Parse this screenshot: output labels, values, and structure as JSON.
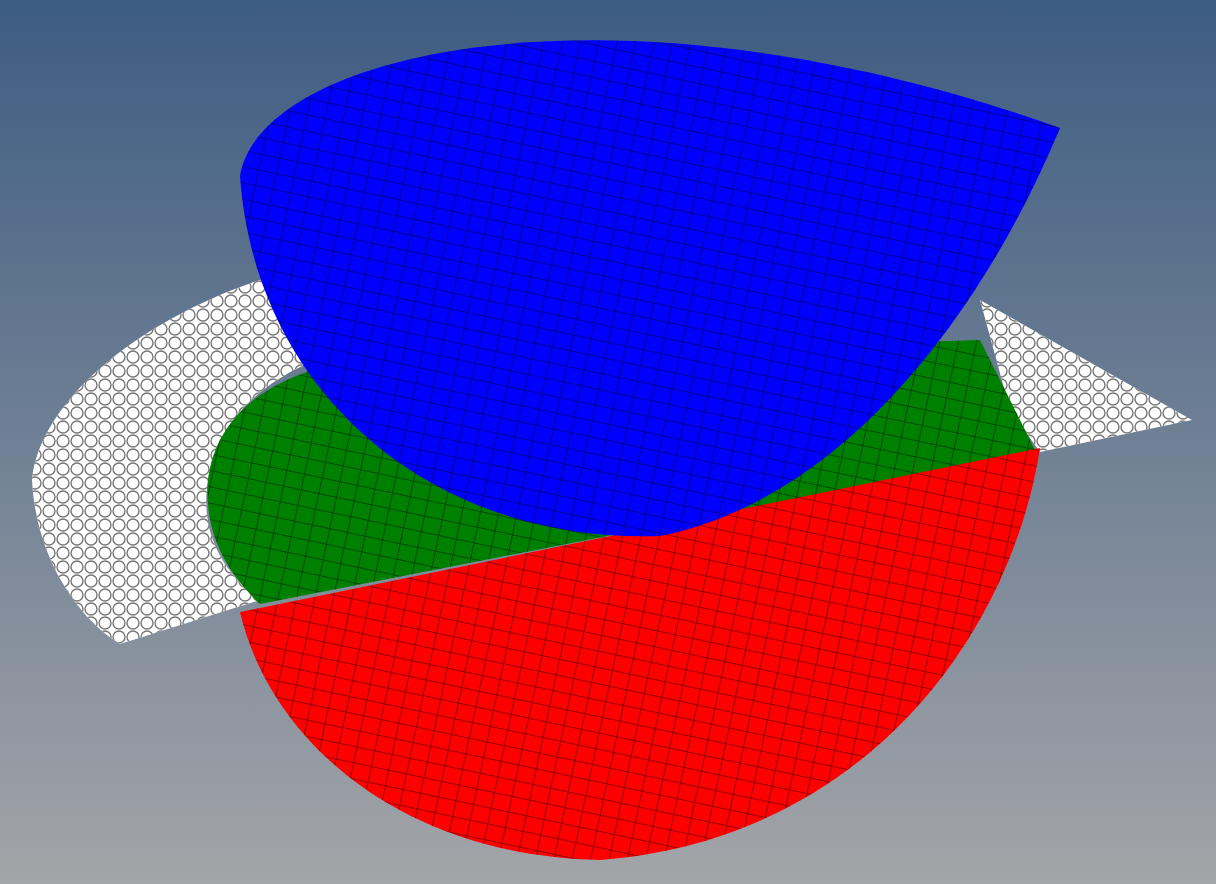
{
  "viewport": {
    "parts": [
      {
        "kind": "particles",
        "color": "#ffffff"
      },
      {
        "kind": "plate",
        "color": "#008000"
      },
      {
        "kind": "lower-shell",
        "color": "#ff0000"
      },
      {
        "kind": "upper-shell",
        "color": "#0000ff"
      }
    ]
  }
}
